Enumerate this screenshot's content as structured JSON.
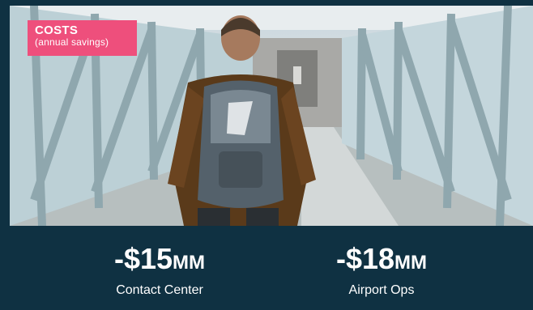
{
  "badge": {
    "title": "COSTS",
    "subtitle": "(annual savings)",
    "color": "#ee4f7c"
  },
  "stats": [
    {
      "value": "-$15",
      "unit": "MM",
      "label": "Contact Center"
    },
    {
      "value": "-$18",
      "unit": "MM",
      "label": "Airport Ops"
    }
  ],
  "colors": {
    "background": "#0f3142",
    "text": "#ffffff"
  },
  "image": {
    "subject": "traveler-with-backpack-in-jet-bridge"
  }
}
